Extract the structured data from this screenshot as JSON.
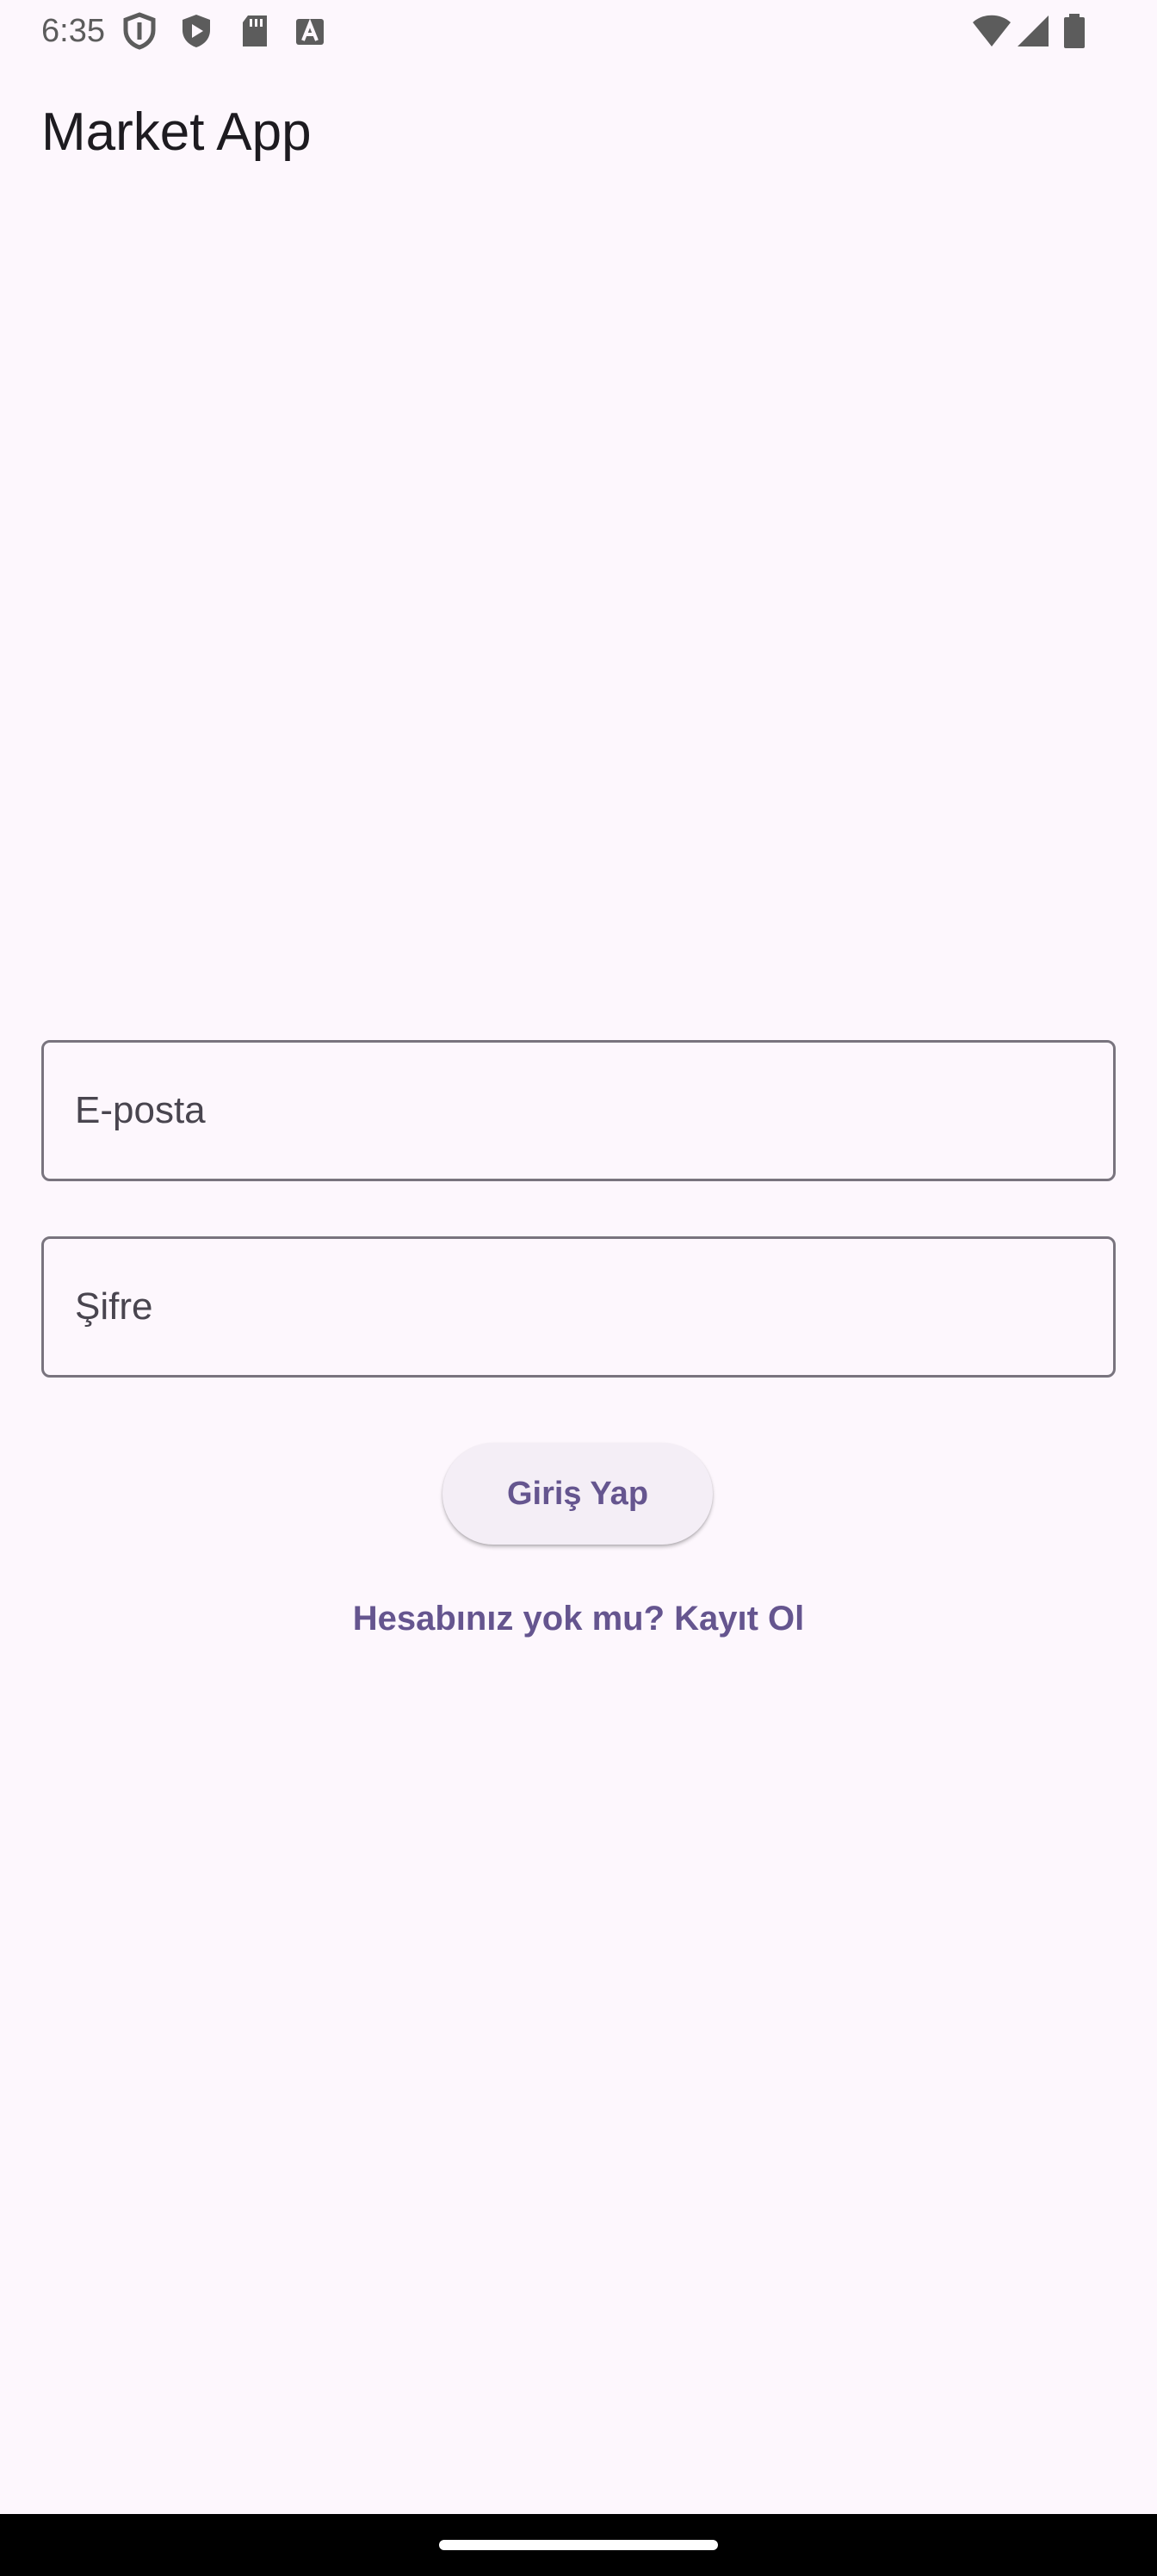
{
  "status_bar": {
    "time": "6:35",
    "left_icons": [
      "shield-outline-icon",
      "shield-play-icon",
      "sd-card-icon",
      "font-a-icon"
    ],
    "right_icons": [
      "wifi-icon",
      "cellular-signal-icon",
      "battery-icon"
    ]
  },
  "app_bar": {
    "title": "Market App"
  },
  "login_form": {
    "email_label": "E-posta",
    "password_label": "Şifre",
    "submit_label": "Giriş Yap",
    "register_link": "Hesabınız yok mu? Kayıt Ol"
  },
  "colors": {
    "background": "#fdf7fd",
    "primary": "#65558f",
    "outline": "#79747e",
    "button_surface": "#f4eef6"
  }
}
